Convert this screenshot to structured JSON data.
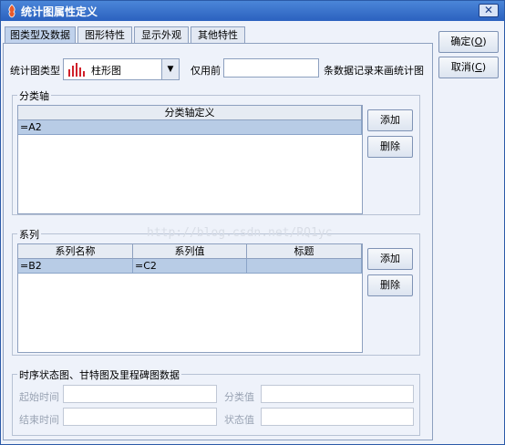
{
  "window": {
    "title": "统计图属性定义"
  },
  "tabs": [
    {
      "label": "图类型及数据"
    },
    {
      "label": "图形特性"
    },
    {
      "label": "显示外观"
    },
    {
      "label": "其他特性"
    }
  ],
  "chart_type": {
    "label": "统计图类型",
    "value": "柱形图",
    "use_first_prefix": "仅用前",
    "use_first_value": "",
    "use_first_suffix": "条数据记录来画统计图"
  },
  "category_axis": {
    "group_title": "分类轴",
    "column_header": "分类轴定义",
    "rows": [
      "=A2"
    ],
    "add_label": "添加",
    "delete_label": "删除"
  },
  "series": {
    "group_title": "系列",
    "columns": [
      "系列名称",
      "系列值",
      "标题"
    ],
    "rows": [
      [
        "=B2",
        "=C2",
        ""
      ]
    ],
    "add_label": "添加",
    "delete_label": "删除"
  },
  "timeline": {
    "group_title": "时序状态图、甘特图及里程碑图数据",
    "start_time_label": "起始时间",
    "end_time_label": "结束时间",
    "category_value_label": "分类值",
    "status_value_label": "状态值"
  },
  "buttons": {
    "ok": "确定",
    "ok_key": "O",
    "cancel": "取消",
    "cancel_key": "C"
  },
  "watermark": "http://blog.csdn.net/RQ1yc"
}
